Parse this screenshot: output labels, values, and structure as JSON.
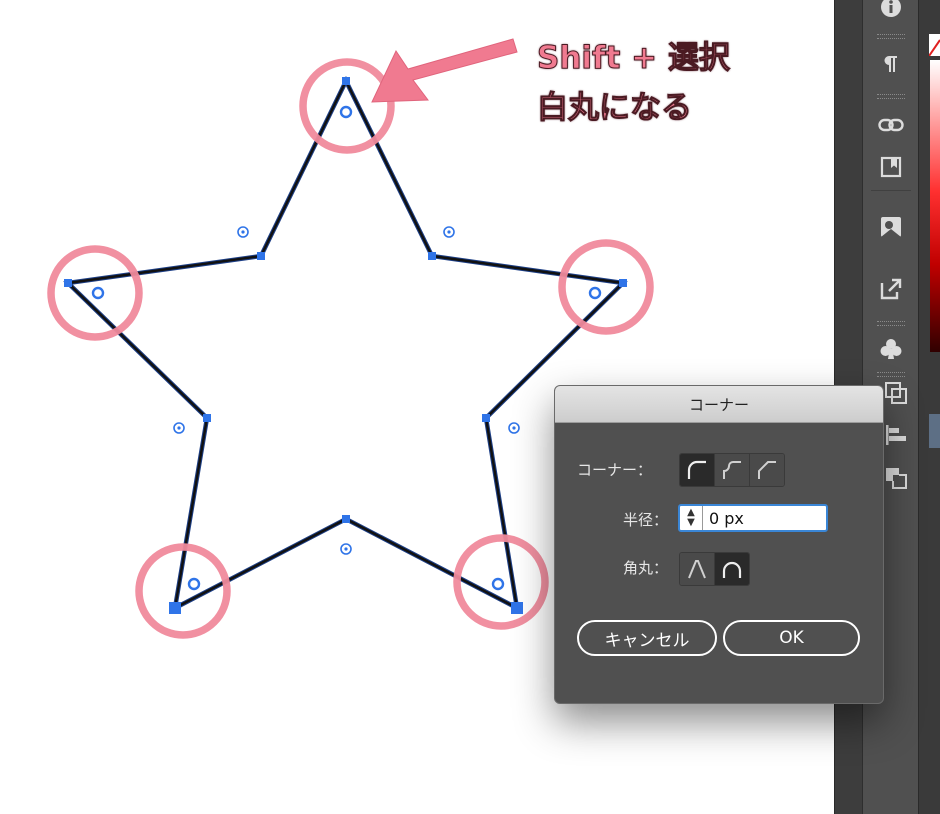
{
  "annotation": {
    "line1": "Shift + 選択",
    "line2": "白丸になる",
    "color": "#f07a90"
  },
  "dialog": {
    "title": "コーナー",
    "corner_label": "コーナー：",
    "radius_label": "半径：",
    "radius_value": "0 px",
    "rounding_label": "角丸：",
    "cancel_label": "キャンセル",
    "ok_label": "OK",
    "corner_options": [
      "round",
      "inverted-round",
      "chamfer"
    ],
    "corner_selected": "round",
    "rounding_options": [
      "relative",
      "absolute"
    ],
    "rounding_selected": "absolute"
  },
  "panel_icons": [
    "info-icon",
    "paragraph-icon",
    "link-icon",
    "artboard-icon",
    "image-trace-icon",
    "export-icon",
    "club-symbol-icon",
    "transform-icon",
    "align-icon",
    "pathfinder-icon"
  ],
  "colors": {
    "path": "#111111",
    "anchor": "#2f74e8",
    "highlight": "#f08a9c",
    "ui_dark": "#505050"
  }
}
